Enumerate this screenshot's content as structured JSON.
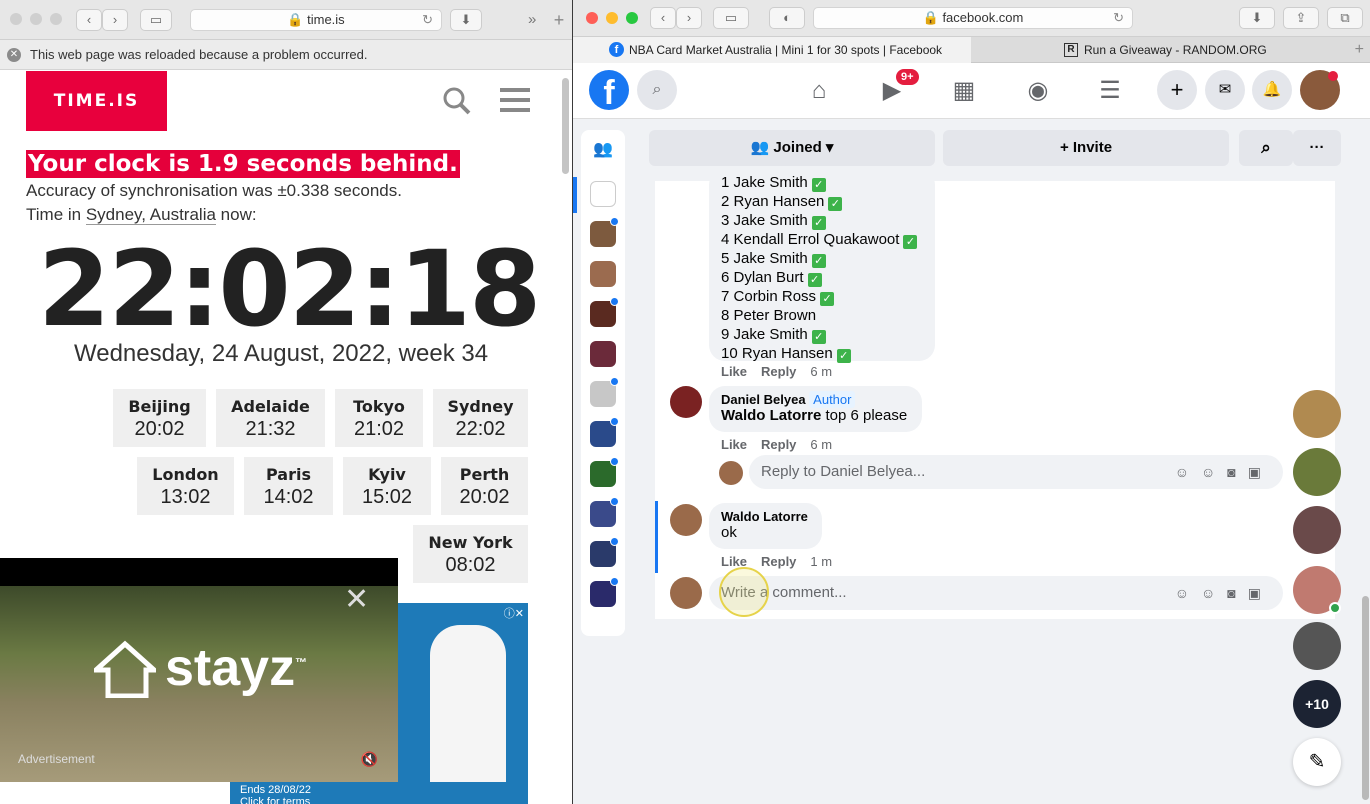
{
  "left": {
    "address": "time.is",
    "banner": "This web page was reloaded because a problem occurred.",
    "logo": "TIME.IS",
    "behind": "Your clock is 1.9 seconds behind.",
    "accuracy": "Accuracy of synchronisation was ±0.338 seconds.",
    "time_in_prefix": "Time in",
    "place": "Sydney, Australia",
    "time_in_suffix": "now:",
    "clock": "22:02:18",
    "date": "Wednesday, 24 August, 2022, week 34",
    "cities": [
      {
        "name": "Beijing",
        "time": "20:02"
      },
      {
        "name": "Adelaide",
        "time": "21:32"
      },
      {
        "name": "Tokyo",
        "time": "21:02"
      },
      {
        "name": "Sydney",
        "time": "22:02"
      },
      {
        "name": "London",
        "time": "13:02"
      },
      {
        "name": "Paris",
        "time": "14:02"
      },
      {
        "name": "Kyiv",
        "time": "15:02"
      },
      {
        "name": "Perth",
        "time": "20:02"
      },
      {
        "name": "New York",
        "time": "08:02"
      }
    ],
    "ad": {
      "brand": "stayz",
      "tm": "™",
      "label": "Advertisement",
      "ends": "Ends 28/08/22",
      "click": "Click for terms"
    }
  },
  "right": {
    "address": "facebook.com",
    "tabs": [
      "NBA Card Market Australia | Mini 1 for 30 spots | Facebook",
      "Run a Giveaway - RANDOM.ORG"
    ],
    "notif_badge": "9+",
    "joined": "Joined",
    "invite": "Invite",
    "list": [
      {
        "n": "1",
        "name": "Jake Smith",
        "check": true
      },
      {
        "n": "2",
        "name": "Ryan Hansen",
        "check": true
      },
      {
        "n": "3",
        "name": "Jake Smith",
        "check": true
      },
      {
        "n": "4",
        "name": "Kendall Errol Quakawoot",
        "check": true
      },
      {
        "n": "5",
        "name": "Jake Smith",
        "check": true
      },
      {
        "n": "6",
        "name": "Dylan Burt",
        "check": true
      },
      {
        "n": "7",
        "name": "Corbin Ross",
        "check": true
      },
      {
        "n": "8",
        "name": "Peter Brown",
        "check": false
      },
      {
        "n": "9",
        "name": "Jake Smith",
        "check": true
      },
      {
        "n": "10",
        "name": "Ryan Hansen",
        "check": true
      }
    ],
    "like": "Like",
    "reply": "Reply",
    "time1": "6 m",
    "c1": {
      "author": "Daniel Belyea",
      "badge": "Author",
      "mention": "Waldo Latorre",
      "text": "top 6 please",
      "time": "6 m"
    },
    "reply_placeholder": "Reply to Daniel Belyea...",
    "c2": {
      "author": "Waldo Latorre",
      "text": "ok",
      "time": "1 m"
    },
    "comment_placeholder": "Write a comment...",
    "more_chats": "+10"
  }
}
